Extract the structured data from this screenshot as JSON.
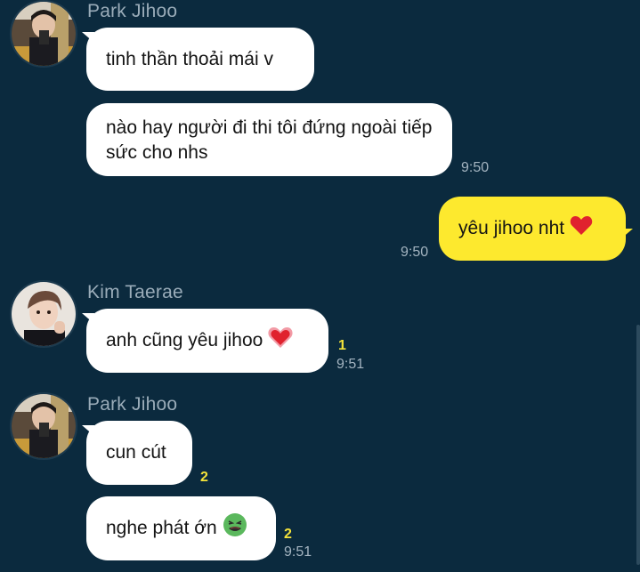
{
  "colors": {
    "background": "#0b2a3e",
    "my_bubble": "#fde92e",
    "their_bubble": "#ffffff",
    "unread": "#f4e23a"
  },
  "messages": [
    {
      "sender": "Park Jihoo",
      "text": "tinh thần thoải mái v"
    },
    {
      "text": "nào hay người đi thi tôi đứng ngoài tiếp sức cho nhs",
      "time": "9:50"
    },
    {
      "text": "yêu jihoo nht",
      "emoji": "heart-icon",
      "time": "9:50"
    },
    {
      "sender": "Kim Taerae",
      "text": "anh cũng yêu jihoo",
      "emoji": "growing-heart-icon",
      "unread": "1",
      "time": "9:51"
    },
    {
      "sender": "Park Jihoo",
      "text": "cun cút",
      "unread": "2"
    },
    {
      "text": "nghe phát ớn",
      "emoji": "nauseated-face-icon",
      "unread": "2",
      "time": "9:51"
    }
  ]
}
